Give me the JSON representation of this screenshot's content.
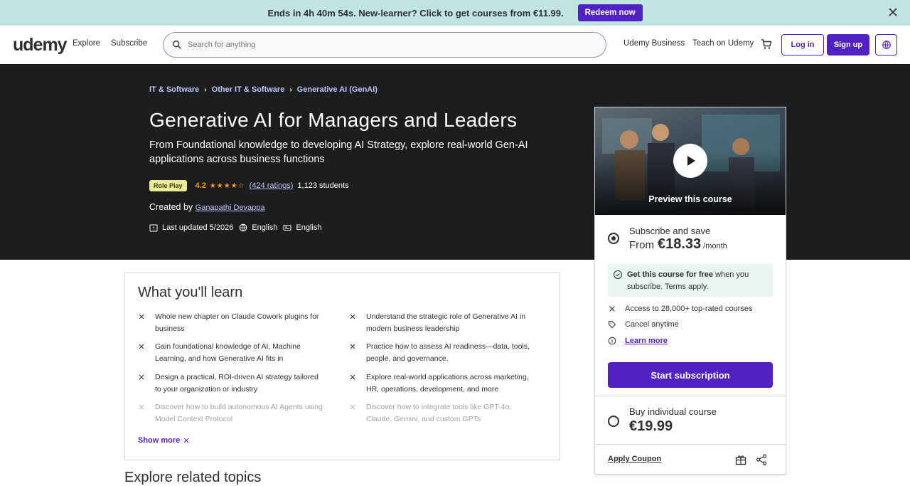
{
  "banner": {
    "text": "Ends in 4h 40m 54s. New-learner? Click to get courses from €11.99.",
    "redeem_label": "Redeem now"
  },
  "header": {
    "logo": "udemy",
    "explore": "Explore",
    "subscribe": "Subscribe",
    "search_placeholder": "Search for anything",
    "business": "Udemy Business",
    "teach": "Teach on Udemy",
    "login": "Log in",
    "signup": "Sign up"
  },
  "breadcrumb": [
    "IT & Software",
    "Other IT & Software",
    "Generative AI (GenAI)"
  ],
  "course": {
    "title": "Generative AI for Managers and Leaders",
    "subtitle": "From Foundational knowledge to developing AI Strategy, explore real-world Gen-AI applications across business functions",
    "badge": "Role Play",
    "rating": "4.2",
    "stars": "★★★★☆",
    "ratings_count": "(424 ratings)",
    "students": "1,123 students",
    "created_by_label": "Created by",
    "author": "Ganapathi Devappa",
    "last_updated": "Last updated 5/2026",
    "language": "English",
    "captions": "English"
  },
  "sidebar": {
    "preview_label": "Preview this course",
    "subscribe_title": "Subscribe and save",
    "subscribe_from": "From",
    "subscribe_price": "€18.33",
    "subscribe_per": "/month",
    "free_bold": "Get this course for free",
    "free_rest": " when you subscribe. Terms apply.",
    "features": [
      "Access to 28,000+ top-rated courses",
      "Cancel anytime",
      "Learn more"
    ],
    "start_label": "Start subscription",
    "buy_title": "Buy individual course",
    "buy_price": "€19.99",
    "coupon_label": "Apply Coupon"
  },
  "learn": {
    "title": "What you'll learn",
    "items": [
      "Whole new chapter on Claude Cowork plugins for business",
      "Understand the strategic role of Generative AI in modern business leadership",
      "Gain foundational knowledge of AI, Machine Learning, and how Generative AI fits in",
      "Practice how to assess AI readiness—data, tools, people, and governance.",
      "Design a practical, ROI-driven AI strategy tailored to your organization or industry",
      "Explore real-world applications across marketing, HR, operations, development, and more",
      "Discover how to build autonomous AI Agents using Model Context Protocol",
      "Discover how to integrate tools like GPT-4o, Claude, Gemini, and custom GPTs"
    ],
    "show_more": "Show more"
  },
  "next_section_heading": "Explore related topics",
  "colors": {
    "accent": "#5022c3",
    "banner": "#c0e4e2",
    "hero": "#1c1d1f",
    "star": "#f69c08"
  }
}
